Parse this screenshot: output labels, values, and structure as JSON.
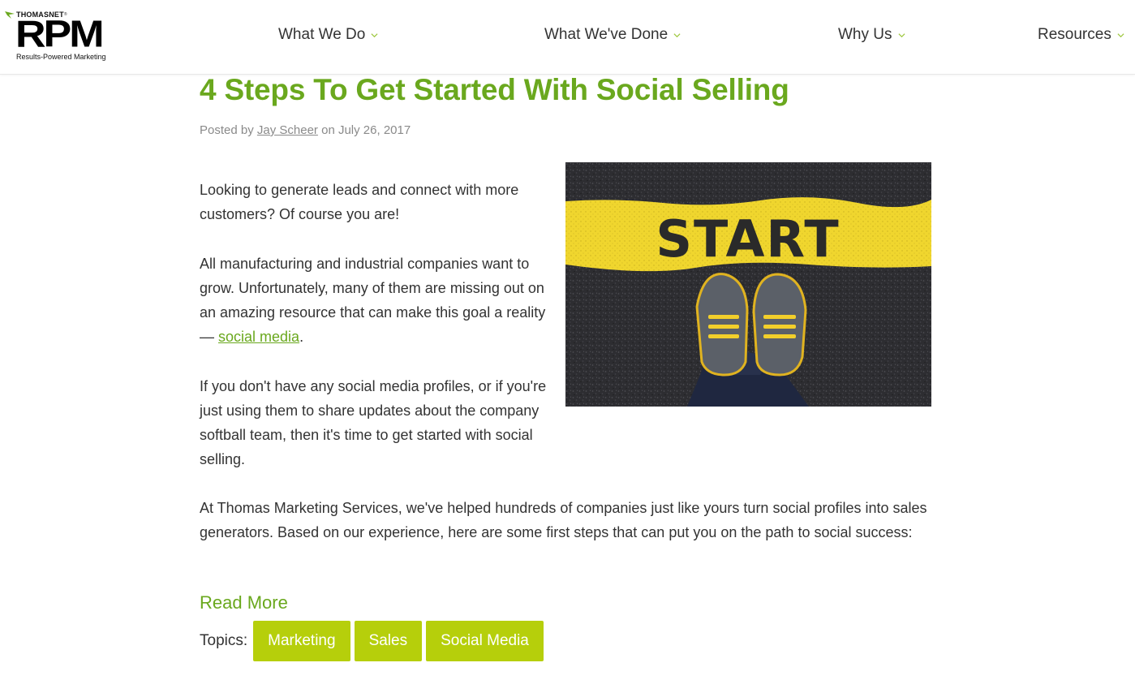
{
  "header": {
    "logo": {
      "brand": "THOMASNET",
      "tm": "®",
      "name": "RPM",
      "tagline": "Results-Powered Marketing"
    },
    "nav": [
      {
        "label": "What We Do",
        "icon": "chevron-down-icon"
      },
      {
        "label": "What We've Done",
        "icon": "chevron-down-icon"
      },
      {
        "label": "Why Us",
        "icon": "chevron-down-icon"
      },
      {
        "label": "Resources",
        "icon": "chevron-down-icon"
      }
    ]
  },
  "article": {
    "title": "4 Steps To Get Started With Social Selling",
    "byline": {
      "prefix": "Posted by",
      "author": "Jay Scheer",
      "middle": "on",
      "date": "July 26, 2017"
    },
    "image": {
      "text": "START"
    },
    "paragraphs": {
      "p1": "Looking to generate leads and connect with more customers? Of course you are!",
      "p2_text": "All manufacturing and industrial companies want to grow. Unfortunately, many of them are missing out on an amazing resource that can make this goal a reality — ",
      "p2_link": "social media",
      "p2_end": ".",
      "p3": "If you don't have any social media profiles, or if you're just using them to share updates about the company softball team, then it's time to get started with social selling.",
      "p4": "At Thomas Marketing Services, we've helped hundreds of companies just like yours turn social profiles into sales generators. Based on our experience, here are some first steps that can put you on the path to social success:"
    },
    "read_more": "Read More",
    "topics": {
      "label": "Topics:",
      "tags": [
        "Marketing",
        "Sales",
        "Social Media"
      ]
    }
  },
  "colors": {
    "accent_green": "#6aa81e",
    "tag_green": "#b6cf0b",
    "road_yellow": "#f2d92e",
    "asphalt": "#2b2b2e"
  }
}
